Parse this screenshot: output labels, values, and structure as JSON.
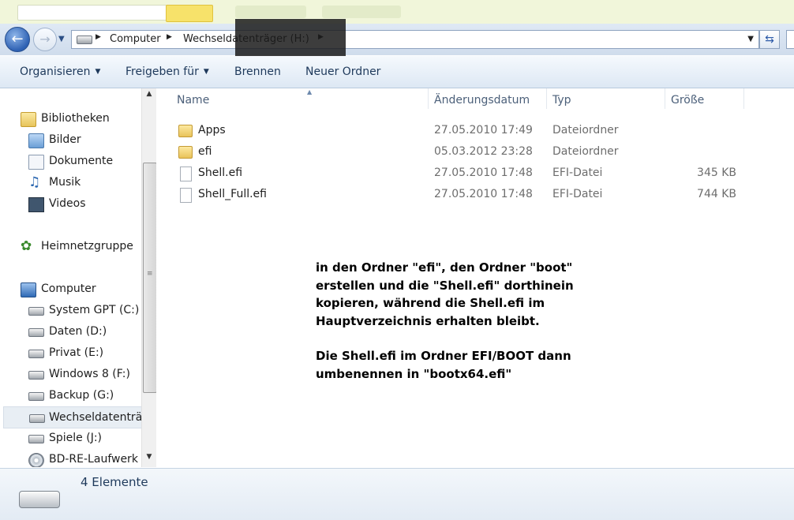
{
  "window": {
    "address_crumbs": [
      "Computer",
      "Wechseldatenträger (H:)"
    ]
  },
  "toolbar": {
    "organize": "Organisieren",
    "share": "Freigeben für",
    "burn": "Brennen",
    "new_folder": "Neuer Ordner"
  },
  "sidebar": {
    "libraries": "Bibliotheken",
    "library_items": [
      "Bilder",
      "Dokumente",
      "Musik",
      "Videos"
    ],
    "homegroup": "Heimnetzgruppe",
    "computer": "Computer",
    "drives": [
      "System GPT (C:)",
      "Daten (D:)",
      "Privat (E:)",
      "Windows 8 (F:)",
      "Backup (G:)",
      "Wechseldatenträg",
      "Spiele (J:)",
      "BD-RE-Laufwerk ("
    ],
    "selected_drive_index": 5
  },
  "columns": {
    "name": "Name",
    "date": "Änderungsdatum",
    "type": "Typ",
    "size": "Größe"
  },
  "files": [
    {
      "name": "Apps",
      "date": "27.05.2010 17:49",
      "type": "Dateiordner",
      "size": "",
      "icon": "folder-icon"
    },
    {
      "name": "efi",
      "date": "05.03.2012 23:28",
      "type": "Dateiordner",
      "size": "",
      "icon": "folder-icon"
    },
    {
      "name": "Shell.efi",
      "date": "27.05.2010 17:48",
      "type": "EFI-Datei",
      "size": "345 KB",
      "icon": "file-icon"
    },
    {
      "name": "Shell_Full.efi",
      "date": "27.05.2010 17:48",
      "type": "EFI-Datei",
      "size": "744 KB",
      "icon": "file-icon"
    }
  ],
  "annotation": {
    "paragraph1": "in den Ordner \"efi\", den Ordner \"boot\"\nerstellen und die \"Shell.efi\" dorthinein\nkopieren, während die Shell.efi im\nHauptverzeichnis erhalten bleibt.",
    "paragraph2": "Die Shell.efi im Ordner EFI/BOOT dann\numbenennen in \"bootx64.efi\""
  },
  "status": {
    "count": "4 Elemente"
  }
}
